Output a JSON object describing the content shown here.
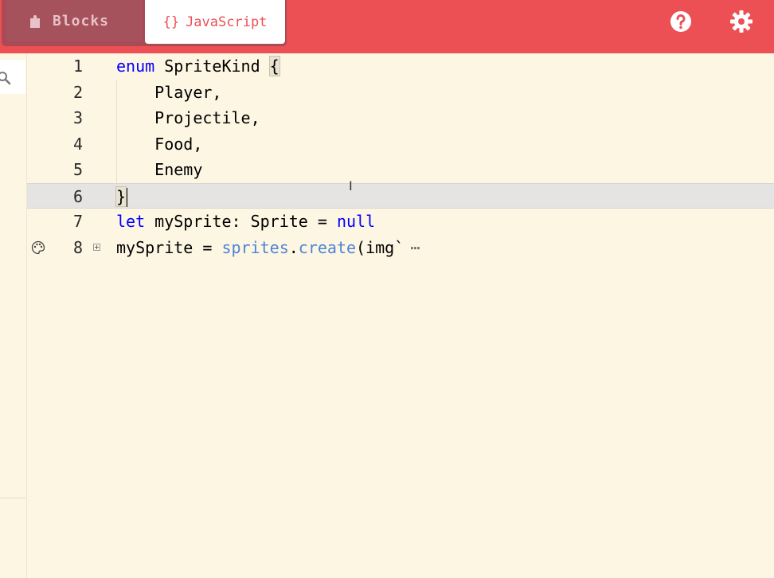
{
  "toolbar": {
    "tabs": [
      {
        "label": "Blocks",
        "active": false
      },
      {
        "label": "JavaScript",
        "braces": "{}",
        "active": true
      }
    ],
    "help_icon": "help-circle-icon",
    "settings_icon": "gear-icon",
    "colors": {
      "bar": "#ec5055",
      "inactive_tab": "#a5525c",
      "active_tab": "#ffffff"
    }
  },
  "sidebar": {
    "search_icon": "search-icon"
  },
  "editor": {
    "background": "#fdf6e3",
    "current_line": 6,
    "lines": [
      {
        "number": "1",
        "tokens": [
          {
            "t": "enum",
            "c": "kw"
          },
          {
            "t": " SpriteKind "
          },
          {
            "t": "{",
            "c": "bracket-hl"
          }
        ]
      },
      {
        "number": "2",
        "tokens": [
          {
            "t": "    Player,"
          }
        ]
      },
      {
        "number": "3",
        "tokens": [
          {
            "t": "    Projectile,"
          }
        ]
      },
      {
        "number": "4",
        "tokens": [
          {
            "t": "    Food,"
          }
        ]
      },
      {
        "number": "5",
        "tokens": [
          {
            "t": "    Enemy"
          }
        ]
      },
      {
        "number": "6",
        "tokens": [
          {
            "t": "}",
            "c": "bracket-hl"
          }
        ],
        "caret": true
      },
      {
        "number": "7",
        "tokens": [
          {
            "t": "let",
            "c": "kw"
          },
          {
            "t": " mySprite: Sprite = "
          },
          {
            "t": "null",
            "c": "kw"
          }
        ]
      },
      {
        "number": "8",
        "tokens": [
          {
            "t": "mySprite = "
          },
          {
            "t": "sprites",
            "c": "fn"
          },
          {
            "t": "."
          },
          {
            "t": "create",
            "c": "fn"
          },
          {
            "t": "(img`"
          }
        ],
        "folded": true,
        "ellipsis": "⋯",
        "glyph_icon": "palette-icon"
      }
    ]
  }
}
